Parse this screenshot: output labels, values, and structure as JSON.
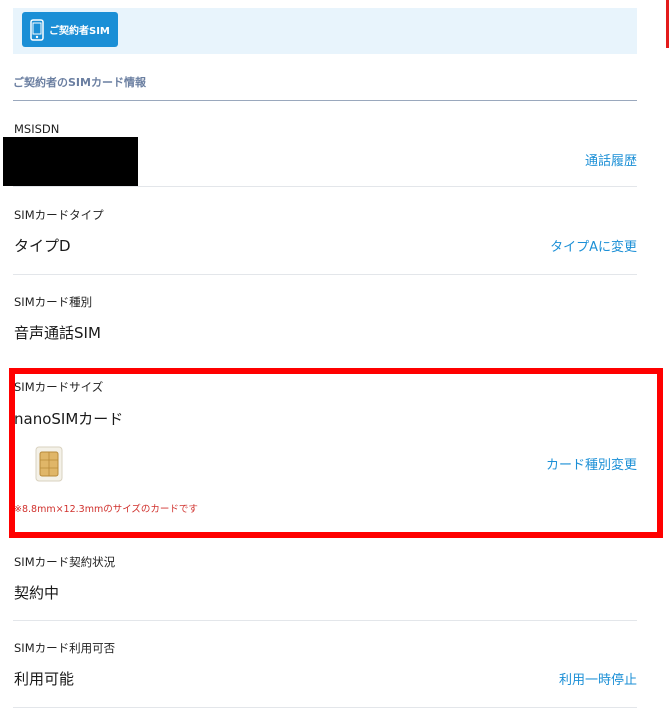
{
  "header": {
    "tab_label": "ご契約者SIM"
  },
  "section": {
    "title": "ご契約者のSIMカード情報"
  },
  "rows": {
    "msisdn": {
      "label": "MSISDN",
      "value": "",
      "link": "通話履歴"
    },
    "sim_type": {
      "label": "SIMカードタイプ",
      "value": "タイプD",
      "link": "タイプAに変更"
    },
    "sim_kind": {
      "label": "SIMカード種別",
      "value": "音声通話SIM"
    },
    "sim_size": {
      "label": "SIMカードサイズ",
      "value": "nanoSIMカード",
      "link": "カード種別変更",
      "note": "※8.8mm×12.3mmのサイズのカードです"
    },
    "contract_status": {
      "label": "SIMカード契約状況",
      "value": "契約中"
    },
    "availability": {
      "label": "SIMカード利用可否",
      "value": "利用可能",
      "link": "利用一時停止"
    }
  },
  "colors": {
    "accent": "#1b8fd6",
    "highlight": "#ff0000",
    "note": "#d0312d"
  },
  "icons": {
    "header": "smartphone-icon",
    "sim": "sim-card-icon"
  }
}
